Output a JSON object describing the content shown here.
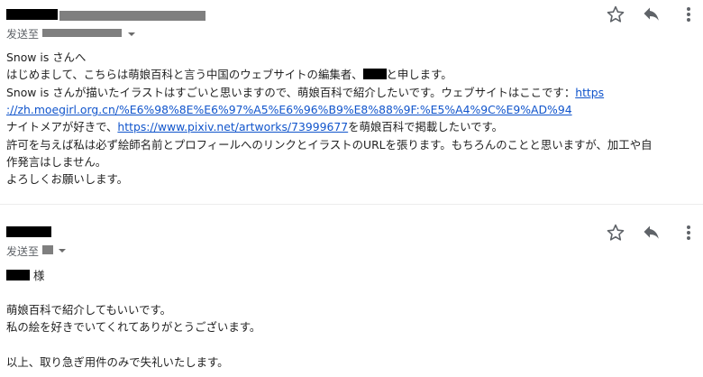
{
  "message1": {
    "to_prefix": "发送至",
    "body": {
      "greeting": "Snow is さんへ",
      "intro_before": "はじめまして、こちらは萌娘百科と言う中国のウェブサイトの編集者、",
      "intro_after": "と申します。",
      "line3_text": "Snow is さんが描いたイラストはすごいと思いますので、萌娘百科で紹介したいです。ウェブサイトはここです：",
      "site_url_part1": "https",
      "site_url_part2": "://zh.moegirl.org.cn/%E6%98%8E%E6%97%A5%E6%96%B9%E8%88%9F:%E5%A4%9C%E9%AD%94",
      "line5_before": "ナイトメアが好きで、",
      "artwork_url": "https://www.pixiv.net/artworks/73999677",
      "line5_after": "を萌娘百科で掲載したいです。",
      "line6": "許可を与えば私は必ず絵師名前とプロフィールへのリンクとイラストのURLを張ります。もちろんのことと思いますが、加工や自",
      "line7": "作発言はしません。",
      "closing": "よろしくお願いします。"
    }
  },
  "message2": {
    "to_prefix": "发送至",
    "body": {
      "salutation_suffix": "様",
      "line1": "萌娘百科で紹介してもいいです。",
      "line2": "私の絵を好きでいてくれてありがとうございます。",
      "line3": "以上、取り急ぎ用件のみで失礼いたします。"
    }
  },
  "icons": [
    "star-icon",
    "reply-icon",
    "more-vert-icon",
    "dropdown-caret-icon"
  ]
}
